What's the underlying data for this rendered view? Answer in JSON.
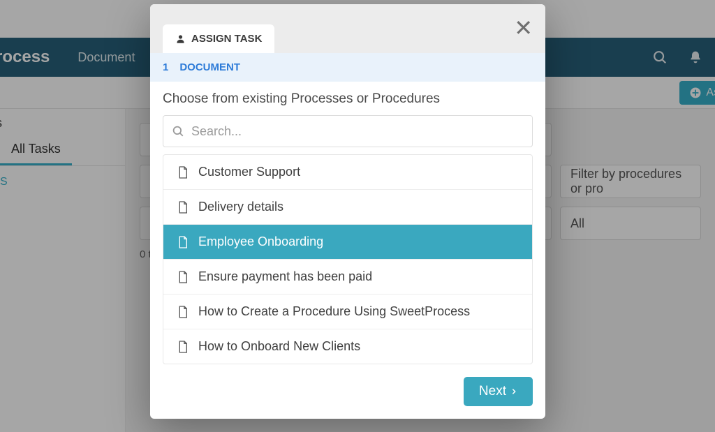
{
  "header": {
    "brand": "Process",
    "nav_document": "Document"
  },
  "subbar": {
    "assign_label": "As"
  },
  "sidebar": {
    "heading": "s",
    "tab_all_tasks": "All Tasks",
    "side_item": "S"
  },
  "main": {
    "count_label": "0 t",
    "filter_placeholder": "Filter by procedures or pro",
    "filter_all": "All"
  },
  "modal": {
    "tab_label": "ASSIGN TASK",
    "step_number": "1",
    "step_label": "DOCUMENT",
    "body_title": "Choose from existing Processes or Procedures",
    "search_placeholder": "Search...",
    "items": [
      {
        "label": "Customer Support",
        "selected": false
      },
      {
        "label": "Delivery details",
        "selected": false
      },
      {
        "label": "Employee Onboarding",
        "selected": true
      },
      {
        "label": "Ensure payment has been paid",
        "selected": false
      },
      {
        "label": "How to Create a Procedure Using SweetProcess",
        "selected": false
      },
      {
        "label": "How to Onboard New Clients",
        "selected": false
      }
    ],
    "next_label": "Next"
  }
}
